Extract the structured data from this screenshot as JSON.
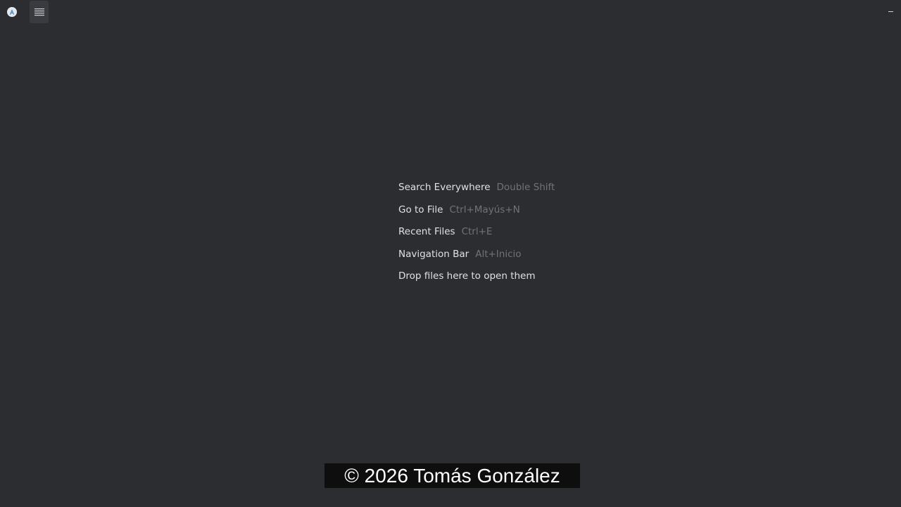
{
  "titlebar": {
    "app_icon": "android-studio-icon",
    "menu_icon": "hamburger-menu-icon",
    "minimize_icon": "minimize-icon",
    "minimize_label": "–"
  },
  "empty_state": {
    "hints": [
      {
        "action": "Search Everywhere",
        "shortcut": "Double Shift"
      },
      {
        "action": "Go to File",
        "shortcut": "Ctrl+Mayús+N"
      },
      {
        "action": "Recent Files",
        "shortcut": "Ctrl+E"
      },
      {
        "action": "Navigation Bar",
        "shortcut": "Alt+Inicio"
      },
      {
        "action": "Drop files here to open them",
        "shortcut": ""
      }
    ]
  },
  "watermark": {
    "text": "© 2026 Tomás González"
  },
  "colors": {
    "background": "#2b2d30",
    "text_primary": "#dfe1e5",
    "text_secondary": "#6f737a",
    "menu_button_bg": "#393b40"
  }
}
